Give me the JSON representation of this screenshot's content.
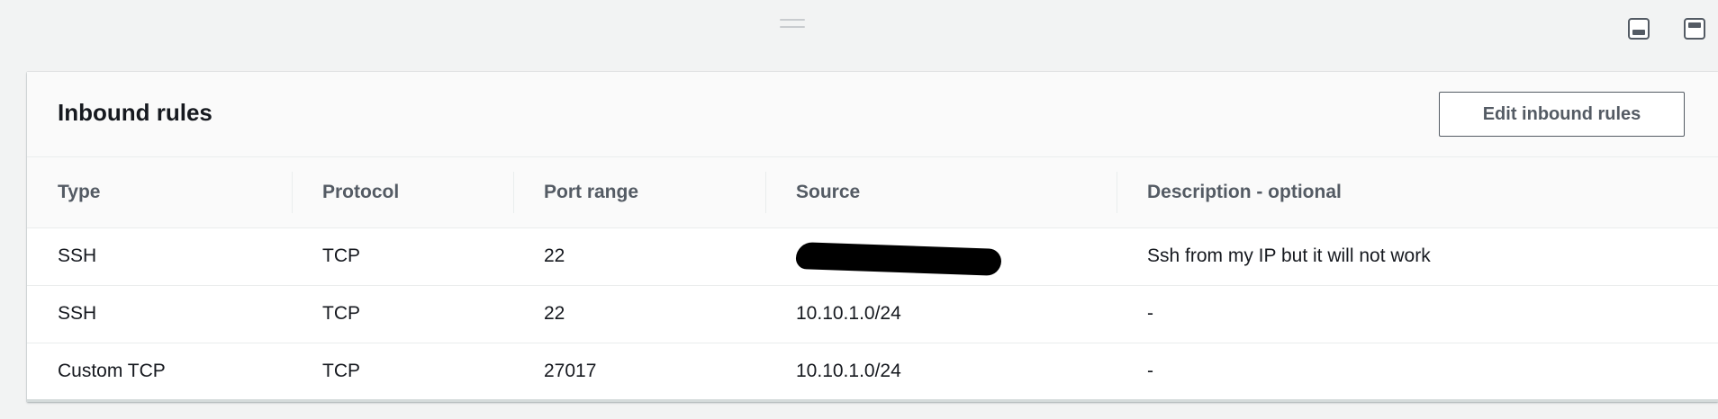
{
  "panel": {
    "title": "Inbound rules",
    "edit_button_label": "Edit inbound rules"
  },
  "table": {
    "columns": [
      "Type",
      "Protocol",
      "Port range",
      "Source",
      "Description - optional"
    ],
    "rows": [
      {
        "type": "SSH",
        "protocol": "TCP",
        "port_range": "22",
        "source": "",
        "source_redacted": true,
        "description": "Ssh from my IP but it will not work"
      },
      {
        "type": "SSH",
        "protocol": "TCP",
        "port_range": "22",
        "source": "10.10.1.0/24",
        "source_redacted": false,
        "description": "-"
      },
      {
        "type": "Custom TCP",
        "protocol": "TCP",
        "port_range": "27017",
        "source": "10.10.1.0/24",
        "source_redacted": false,
        "description": "-"
      }
    ]
  },
  "icons": {
    "drag_handle": "drag-handle-icon",
    "layout_bottom": "panel-bottom-icon",
    "layout_top": "panel-top-icon"
  }
}
